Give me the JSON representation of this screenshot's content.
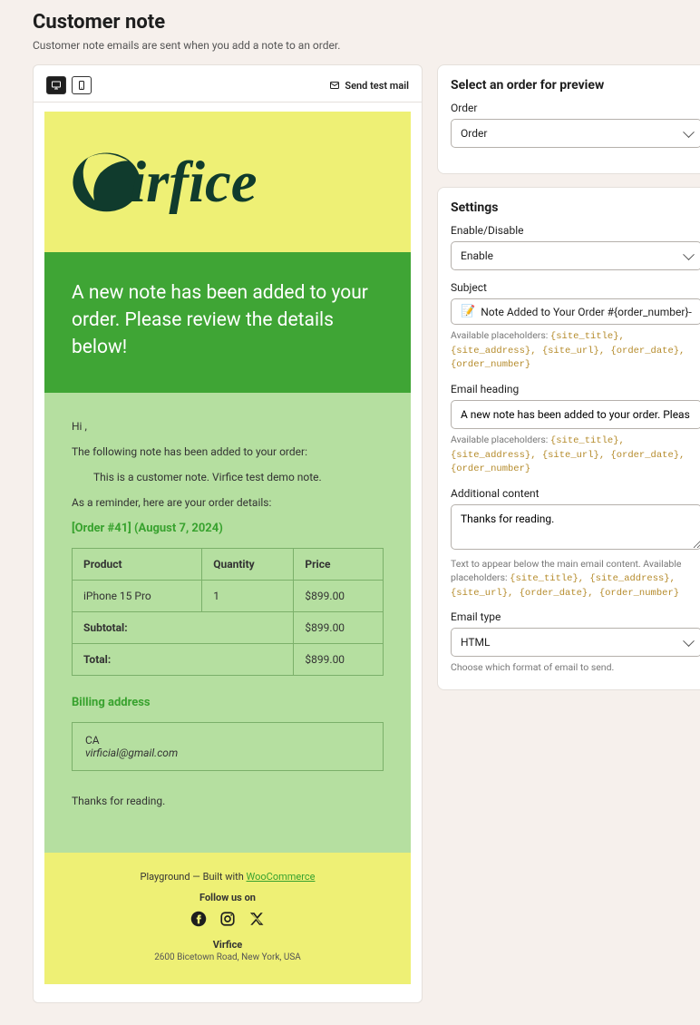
{
  "header": {
    "title": "Customer note",
    "description": "Customer note emails are sent when you add a note to an order."
  },
  "toolbar": {
    "send_test_label": "Send test mail"
  },
  "email": {
    "hero": "A new note has been added to your order. Please review the details below!",
    "greeting": "Hi ,",
    "intro": "The following note has been added to your order:",
    "note": "This is a customer note. Virfice test demo note.",
    "reminder": "As a reminder, here are your order details:",
    "order_ref": "[Order #41] (August 7, 2024)",
    "table": {
      "headers": [
        "Product",
        "Quantity",
        "Price"
      ],
      "rows": [
        [
          "iPhone 15 Pro",
          "1",
          "$899.00"
        ]
      ],
      "subtotal_label": "Subtotal:",
      "subtotal_value": "$899.00",
      "total_label": "Total:",
      "total_value": "$899.00"
    },
    "billing_heading": "Billing address",
    "billing_line1": "CA",
    "billing_line2": "virficial@gmail.com",
    "closing": "Thanks for reading.",
    "footer": {
      "playground_prefix": "Playground — Built with ",
      "playground_link": "WooCommerce",
      "follow": "Follow us on",
      "brand": "Virfice",
      "address": "2600 Bicetown Road, New York, USA"
    }
  },
  "sidebar": {
    "select_order": {
      "heading": "Select an order for preview",
      "label": "Order",
      "value": "Order"
    },
    "settings": {
      "heading": "Settings",
      "enable": {
        "label": "Enable/Disable",
        "value": "Enable"
      },
      "subject": {
        "label": "Subject",
        "value": "Note Added to Your Order #{order_number}-"
      },
      "placeholders_prefix": "Available placeholders: ",
      "placeholders": "{site_title}, {site_address}, {site_url}, {order_date}, {order_number}",
      "heading_field": {
        "label": "Email heading",
        "value": "A new note has been added to your order. Pleas"
      },
      "additional": {
        "label": "Additional content",
        "value": "Thanks for reading."
      },
      "additional_hint_prefix": "Text to appear below the main email content. Available placeholders: ",
      "email_type": {
        "label": "Email type",
        "value": "HTML",
        "hint": "Choose which format of email to send."
      }
    }
  }
}
